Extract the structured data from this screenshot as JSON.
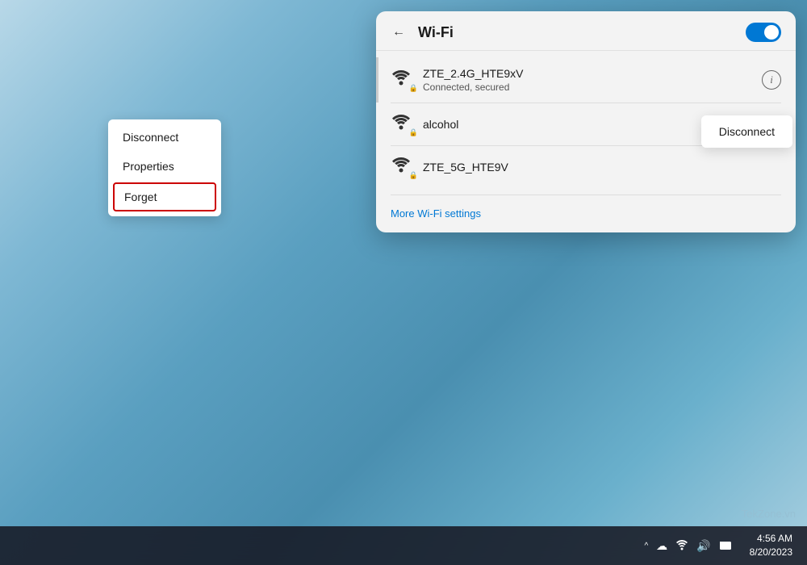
{
  "background": {
    "description": "Windows 11 blue abstract wallpaper"
  },
  "panel": {
    "title": "Wi-Fi",
    "back_label": "←",
    "toggle_on": true
  },
  "networks": [
    {
      "name": "ZTE_2.4G_HTE9xV",
      "status": "Connected, secured",
      "secured": true,
      "connected": true
    },
    {
      "name": "alcohol",
      "status": "",
      "secured": true,
      "connected": false
    },
    {
      "name": "ZTE_5G_HTE9V",
      "status": "",
      "secured": true,
      "connected": false
    }
  ],
  "context_menu": {
    "items": [
      {
        "label": "Disconnect"
      },
      {
        "label": "Properties"
      },
      {
        "label": "Forget"
      }
    ]
  },
  "disconnect_button": {
    "label": "Disconnect"
  },
  "footer": {
    "more_settings": "More Wi-Fi settings"
  },
  "taskbar": {
    "time": "4:56 AM",
    "date": "8/20/2023",
    "icons": {
      "chevron": "^",
      "cloud": "☁",
      "wifi": "WiFi",
      "volume": "🔊",
      "files": "📁"
    }
  },
  "watermark": {
    "text": "TekZone.vn"
  }
}
